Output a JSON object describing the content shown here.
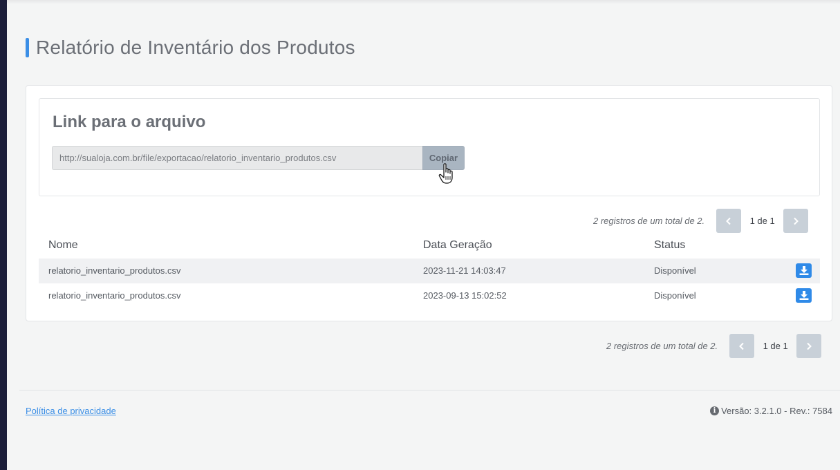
{
  "page": {
    "title": "Relatório de Inventário dos Produtos"
  },
  "link_section": {
    "title": "Link para o arquivo",
    "url": "http://sualoja.com.br/file/exportacao/relatorio_inventario_produtos.csv",
    "copy_label": "Copiar"
  },
  "pagination_top": {
    "info": "2 registros de um total de 2.",
    "page": "1 de 1"
  },
  "pagination_bottom": {
    "info": "2 registros de um total de 2.",
    "page": "1 de 1"
  },
  "table": {
    "headers": [
      "Nome",
      "Data Geração",
      "Status"
    ],
    "rows": [
      {
        "name": "relatorio_inventario_produtos.csv",
        "date": "2023-11-21 14:03:47",
        "status": "Disponível"
      },
      {
        "name": "relatorio_inventario_produtos.csv",
        "date": "2023-09-13 15:02:52",
        "status": "Disponível"
      }
    ]
  },
  "footer": {
    "privacy_label": "Política de privacidade",
    "version": "Versão: 3.2.1.0 - Rev.: 7584"
  },
  "colors": {
    "accent": "#3a8ee6",
    "sidebar": "#1c1f3a",
    "download_button": "#2f8ae8"
  },
  "icons": {
    "prev": "chevron-left-icon",
    "next": "chevron-right-icon",
    "download": "download-icon",
    "info": "info-icon",
    "cursor": "hand-pointer-icon"
  }
}
